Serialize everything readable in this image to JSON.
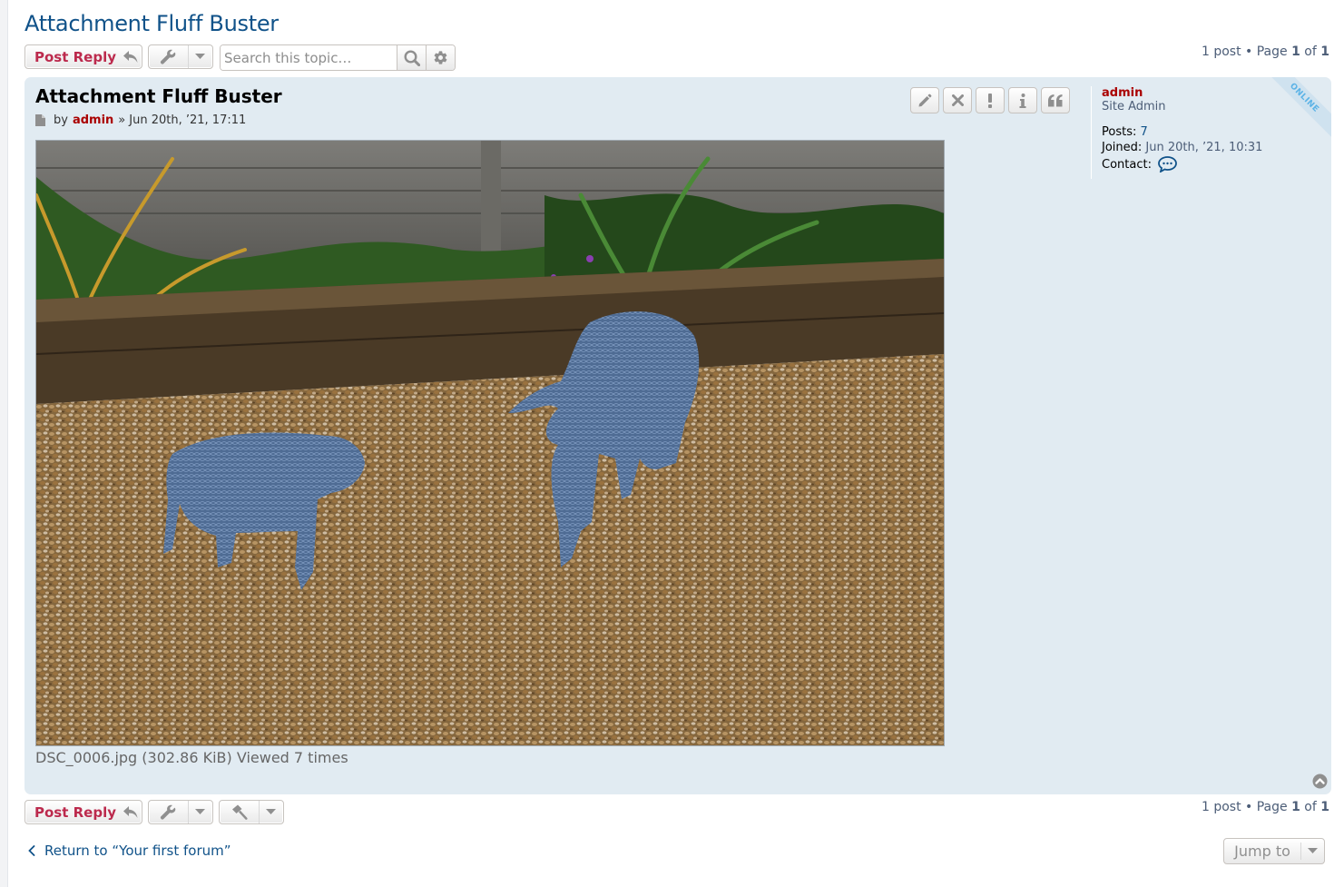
{
  "topic": {
    "title": "Attachment Fluff Buster"
  },
  "actions": {
    "post_reply_label": "Post Reply",
    "search_placeholder": "Search this topic…",
    "jump_to_label": "Jump to",
    "return_prefix": "Return to ",
    "return_forum": "“Your first forum”"
  },
  "pagination": {
    "post_count": "1 post",
    "separator": "•",
    "page_label": "Page",
    "current": "1",
    "of_label": "of",
    "total": "1"
  },
  "post": {
    "title": "Attachment Fluff Buster",
    "by_label": "by",
    "author": "admin",
    "date_sep": "»",
    "date": "Jun 20th, ’21, 17:11",
    "attachment_caption": "DSC_0006.jpg (302.86 KiB) Viewed 7 times"
  },
  "profile": {
    "username": "admin",
    "rank": "Site Admin",
    "posts_label": "Posts:",
    "posts_value": "7",
    "joined_label": "Joined:",
    "joined_value": "Jun 20th, ’21, 10:31",
    "contact_label": "Contact:",
    "online_label": "ONLINE"
  },
  "colors": {
    "title": "#105289",
    "reply": "#bc2a4d",
    "post_bg": "#e1ebf2",
    "admin": "#aa0000",
    "online": "#5ab2e6"
  },
  "icons": [
    "reply-icon",
    "wrench-icon",
    "caret-down-icon",
    "search-icon",
    "gear-icon",
    "edit-icon",
    "delete-icon",
    "report-icon",
    "info-icon",
    "quote-icon",
    "file-icon",
    "contact-icon",
    "back-to-top-icon",
    "hammer-icon",
    "chevron-left-icon"
  ]
}
